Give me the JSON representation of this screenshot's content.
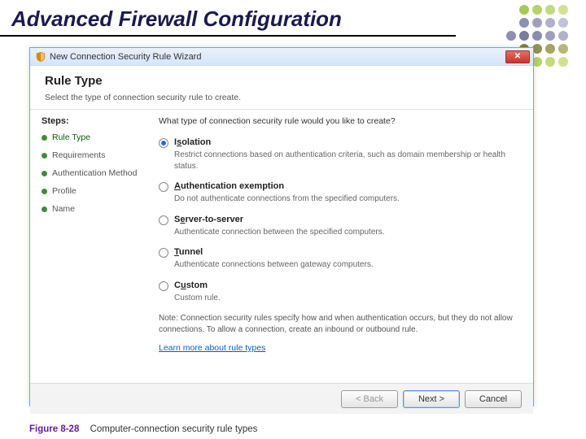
{
  "slide_title": "Advanced Firewall Configuration",
  "window": {
    "title": "New Connection Security Rule Wizard",
    "header": "Rule Type",
    "subtitle": "Select the type of connection security rule to create."
  },
  "steps": {
    "heading": "Steps:",
    "items": [
      {
        "label": "Rule Type",
        "active": true
      },
      {
        "label": "Requirements",
        "active": false
      },
      {
        "label": "Authentication Method",
        "active": false
      },
      {
        "label": "Profile",
        "active": false
      },
      {
        "label": "Name",
        "active": false
      }
    ]
  },
  "content": {
    "prompt": "What type of connection security rule would you like to create?",
    "options": [
      {
        "label_pre": "I",
        "label_ul": "s",
        "label_post": "olation",
        "selected": true,
        "desc": "Restrict connections based on authentication criteria, such as domain membership or health status."
      },
      {
        "label_pre": "",
        "label_ul": "A",
        "label_post": "uthentication exemption",
        "selected": false,
        "desc": "Do not authenticate connections from the specified computers."
      },
      {
        "label_pre": "S",
        "label_ul": "e",
        "label_post": "rver-to-server",
        "selected": false,
        "desc": "Authenticate connection between the specified computers."
      },
      {
        "label_pre": "",
        "label_ul": "T",
        "label_post": "unnel",
        "selected": false,
        "desc": "Authenticate connections between gateway computers."
      },
      {
        "label_pre": "C",
        "label_ul": "u",
        "label_post": "stom",
        "selected": false,
        "desc": "Custom rule."
      }
    ],
    "note": "Note: Connection security rules specify how and when authentication occurs, but they do not allow connections. To allow a connection, create an inbound or outbound rule.",
    "learn_link": "Learn more about rule types"
  },
  "buttons": {
    "back": "< Back",
    "next": "Next >",
    "cancel": "Cancel"
  },
  "caption": {
    "label": "Figure 8-28",
    "text": "Computer-connection security rule types"
  }
}
